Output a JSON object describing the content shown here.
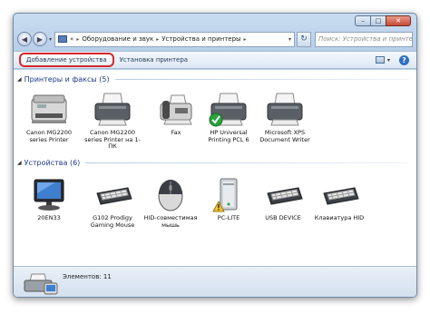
{
  "window": {
    "caption_buttons": {
      "minimize": "–",
      "maximize": "□",
      "close": "✕"
    }
  },
  "nav": {
    "back_glyph": "◀",
    "forward_glyph": "▶",
    "history_glyph": "▾",
    "breadcrumbs": [
      "«",
      "Оборудование и звук",
      "Устройства и принтеры"
    ],
    "separator": "▸",
    "dropdown_glyph": "▾",
    "refresh_glyph": "↻",
    "search_placeholder": "Поиск: Устройства и принтеры"
  },
  "toolbar": {
    "add_device": "Добавление устройства",
    "add_printer": "Установка принтера",
    "view_drop_glyph": "▾",
    "help_glyph": "?"
  },
  "groups": {
    "printers": {
      "title": "Принтеры и факсы (5)",
      "arrow": "◢",
      "items": [
        {
          "label": "Canon MG2200 series Printer",
          "icon": "mfp-printer-icon"
        },
        {
          "label": "Canon MG2200 series Printer на 1-ПК",
          "icon": "printer-icon"
        },
        {
          "label": "Fax",
          "icon": "fax-icon"
        },
        {
          "label": "HP Universal Printing PCL 6",
          "icon": "default-printer-icon"
        },
        {
          "label": "Microsoft XPS Document Writer",
          "icon": "printer-icon"
        }
      ]
    },
    "devices": {
      "title": "Устройства (6)",
      "arrow": "◢",
      "items": [
        {
          "label": "20EN33",
          "icon": "monitor-icon"
        },
        {
          "label": "G102 Prodigy Gaming Mouse",
          "icon": "keyboard-icon"
        },
        {
          "label": "HID-совместимая мышь",
          "icon": "mouse-icon"
        },
        {
          "label": "PC-LITE",
          "icon": "computer-warning-icon"
        },
        {
          "label": "USB DEVICE",
          "icon": "keyboard-icon"
        },
        {
          "label": "Клавиатура HID",
          "icon": "keyboard-icon"
        }
      ]
    }
  },
  "status": {
    "text": "Элементов: 11",
    "icon": "devices-printers-icon"
  },
  "colors": {
    "highlight_border": "#d2292d",
    "group_title": "#1e3c8a",
    "frame": "#b8cfe8",
    "check_green": "#27a33b",
    "warning_yellow": "#f2c12e"
  }
}
